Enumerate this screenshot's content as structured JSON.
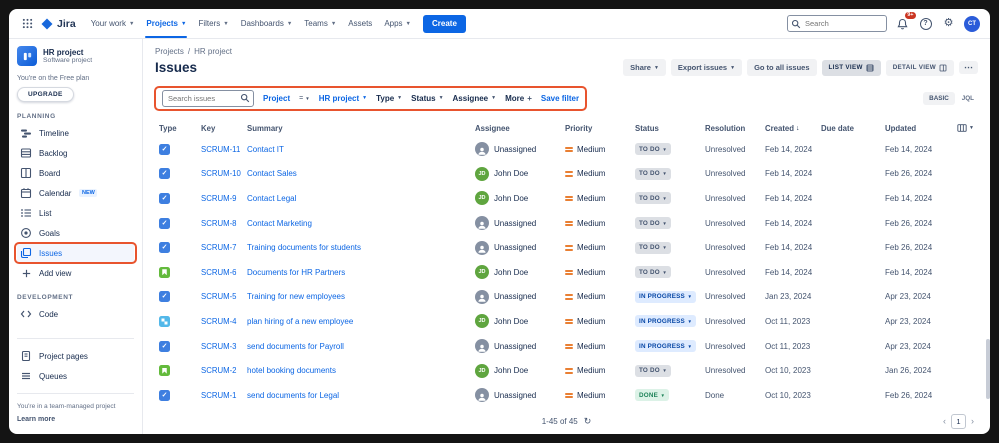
{
  "topnav": {
    "product_name": "Jira",
    "items": [
      {
        "label": "Your work"
      },
      {
        "label": "Projects"
      },
      {
        "label": "Filters"
      },
      {
        "label": "Dashboards"
      },
      {
        "label": "Teams"
      },
      {
        "label": "Assets"
      },
      {
        "label": "Apps"
      }
    ],
    "create_label": "Create",
    "search_placeholder": "Search",
    "notification_badge": "9+",
    "avatar_initials": "CT"
  },
  "sidebar": {
    "project_name": "HR project",
    "project_type": "Software project",
    "plan_note": "You're on the Free plan",
    "upgrade_label": "UPGRADE",
    "planning_label": "PLANNING",
    "planning_items": [
      "Timeline",
      "Backlog",
      "Board",
      "Calendar",
      "List",
      "Goals",
      "Issues"
    ],
    "calendar_badge": "NEW",
    "add_view_label": "Add view",
    "development_label": "DEVELOPMENT",
    "code_label": "Code",
    "project_pages_label": "Project pages",
    "queues_label": "Queues",
    "managed_note": "You're in a team-managed project",
    "learn_more_label": "Learn more"
  },
  "header": {
    "breadcrumb_project": "Projects",
    "breadcrumb_separator": "/",
    "breadcrumb_current": "HR project",
    "title": "Issues",
    "share_label": "Share",
    "export_label": "Export issues",
    "go_to_all_label": "Go to all issues",
    "list_view_label": "LIST VIEW",
    "detail_view_label": "DETAIL VIEW"
  },
  "filterbar": {
    "search_placeholder": "Search issues",
    "project_label": "Project",
    "operator": "=",
    "project_value": "HR project",
    "type_label": "Type",
    "status_label": "Status",
    "assignee_label": "Assignee",
    "more_label": "More",
    "save_filter_label": "Save filter",
    "basic_label": "BASIC",
    "jql_label": "JQL"
  },
  "table": {
    "columns": [
      "Type",
      "Key",
      "Summary",
      "Assignee",
      "Priority",
      "Status",
      "Resolution",
      "Created",
      "Due date",
      "Updated"
    ],
    "rows": [
      {
        "type": "task",
        "key": "SCRUM-11",
        "summary": "Contact IT",
        "assignee": "Unassigned",
        "priority": "Medium",
        "status": "TO DO",
        "status_kind": "todo",
        "resolution": "Unresolved",
        "created": "Feb 14, 2024",
        "due": "",
        "updated": "Feb 14, 2024"
      },
      {
        "type": "task",
        "key": "SCRUM-10",
        "summary": "Contact Sales",
        "assignee": "John Doe",
        "priority": "Medium",
        "status": "TO DO",
        "status_kind": "todo",
        "resolution": "Unresolved",
        "created": "Feb 14, 2024",
        "due": "",
        "updated": "Feb 26, 2024"
      },
      {
        "type": "task",
        "key": "SCRUM-9",
        "summary": "Contact Legal",
        "assignee": "John Doe",
        "priority": "Medium",
        "status": "TO DO",
        "status_kind": "todo",
        "resolution": "Unresolved",
        "created": "Feb 14, 2024",
        "due": "",
        "updated": "Feb 14, 2024"
      },
      {
        "type": "task",
        "key": "SCRUM-8",
        "summary": "Contact Marketing",
        "assignee": "Unassigned",
        "priority": "Medium",
        "status": "TO DO",
        "status_kind": "todo",
        "resolution": "Unresolved",
        "created": "Feb 14, 2024",
        "due": "",
        "updated": "Feb 26, 2024"
      },
      {
        "type": "task",
        "key": "SCRUM-7",
        "summary": "Training documents for students",
        "assignee": "Unassigned",
        "priority": "Medium",
        "status": "TO DO",
        "status_kind": "todo",
        "resolution": "Unresolved",
        "created": "Feb 14, 2024",
        "due": "",
        "updated": "Feb 26, 2024"
      },
      {
        "type": "story",
        "key": "SCRUM-6",
        "summary": "Documents for HR Partners",
        "assignee": "John Doe",
        "priority": "Medium",
        "status": "TO DO",
        "status_kind": "todo",
        "resolution": "Unresolved",
        "created": "Feb 14, 2024",
        "due": "",
        "updated": "Feb 14, 2024"
      },
      {
        "type": "task",
        "key": "SCRUM-5",
        "summary": "Training for new employees",
        "assignee": "Unassigned",
        "priority": "Medium",
        "status": "IN PROGRESS",
        "status_kind": "inprogress",
        "resolution": "Unresolved",
        "created": "Jan 23, 2024",
        "due": "",
        "updated": "Apr 23, 2024"
      },
      {
        "type": "subtask",
        "key": "SCRUM-4",
        "summary": "plan hiring of a new employee",
        "assignee": "John Doe",
        "priority": "Medium",
        "status": "IN PROGRESS",
        "status_kind": "inprogress",
        "resolution": "Unresolved",
        "created": "Oct 11, 2023",
        "due": "",
        "updated": "Apr 23, 2024"
      },
      {
        "type": "task",
        "key": "SCRUM-3",
        "summary": "send documents for Payroll",
        "assignee": "Unassigned",
        "priority": "Medium",
        "status": "IN PROGRESS",
        "status_kind": "inprogress",
        "resolution": "Unresolved",
        "created": "Oct 11, 2023",
        "due": "",
        "updated": "Apr 23, 2024"
      },
      {
        "type": "story",
        "key": "SCRUM-2",
        "summary": "hotel booking documents",
        "assignee": "John Doe",
        "priority": "Medium",
        "status": "TO DO",
        "status_kind": "todo",
        "resolution": "Unresolved",
        "created": "Oct 10, 2023",
        "due": "",
        "updated": "Jan 26, 2024"
      },
      {
        "type": "task",
        "key": "SCRUM-1",
        "summary": "send documents for Legal",
        "assignee": "Unassigned",
        "priority": "Medium",
        "status": "DONE",
        "status_kind": "done",
        "resolution": "Done",
        "created": "Oct 10, 2023",
        "due": "",
        "updated": "Feb 26, 2024"
      }
    ]
  },
  "footer": {
    "range_label": "1-45 of 45",
    "page": "1"
  },
  "colors": {
    "accent": "#0C66E4",
    "annotation": "#E8542E",
    "todo_bg": "#DCDFE4",
    "inprogress_bg": "#DEEBFF",
    "done_bg": "#DCF2E7"
  }
}
